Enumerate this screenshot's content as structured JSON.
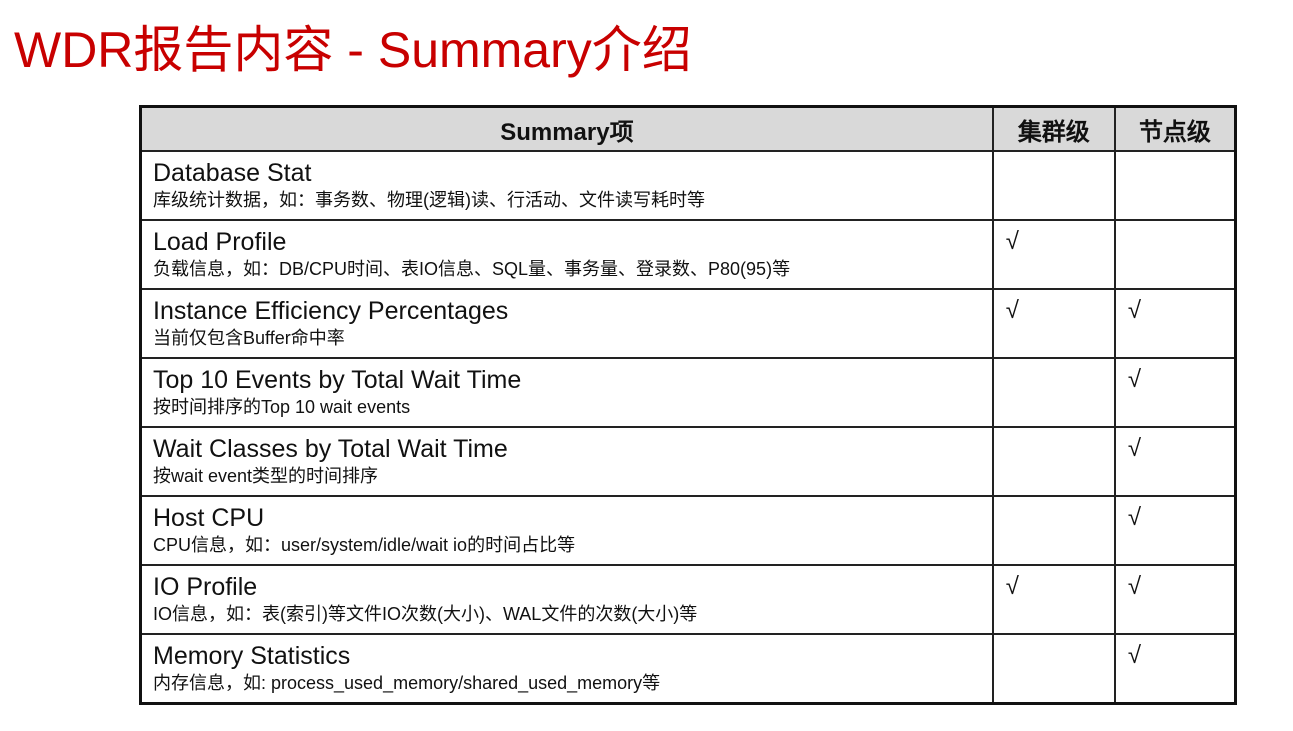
{
  "title": "WDR报告内容 - Summary介绍",
  "table": {
    "headers": [
      "Summary项",
      "集群级",
      "节点级"
    ],
    "check_mark": "√",
    "rows": [
      {
        "name": "Database Stat",
        "desc": "库级统计数据，如：事务数、物理(逻辑)读、行活动、文件读写耗时等",
        "cluster": "",
        "node": ""
      },
      {
        "name": "Load Profile",
        "desc": "负载信息，如：DB/CPU时间、表IO信息、SQL量、事务量、登录数、P80(95)等",
        "cluster": "√",
        "node": ""
      },
      {
        "name": "Instance Efficiency Percentages",
        "desc": "当前仅包含Buffer命中率",
        "cluster": "√",
        "node": "√"
      },
      {
        "name": "Top 10 Events by Total Wait Time",
        "desc": "按时间排序的Top 10 wait events",
        "cluster": "",
        "node": "√"
      },
      {
        "name": "Wait Classes by Total Wait Time",
        "desc": "按wait event类型的时间排序",
        "cluster": "",
        "node": "√"
      },
      {
        "name": "Host CPU",
        "desc": "CPU信息，如：user/system/idle/wait io的时间占比等",
        "cluster": "",
        "node": "√"
      },
      {
        "name": "IO Profile",
        "desc": "IO信息，如：表(索引)等文件IO次数(大小)、WAL文件的次数(大小)等",
        "cluster": "√",
        "node": "√"
      },
      {
        "name": "Memory Statistics",
        "desc": "内存信息，如: process_used_memory/shared_used_memory等",
        "cluster": "",
        "node": "√"
      }
    ]
  }
}
